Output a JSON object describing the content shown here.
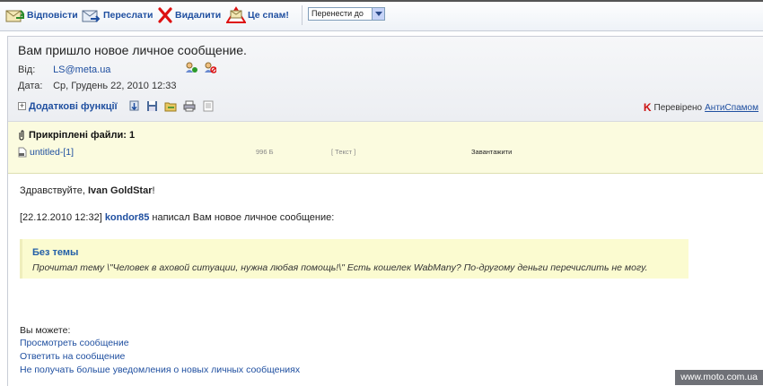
{
  "toolbar": {
    "reply_label": "Відповісти",
    "forward_label": "Переслати",
    "delete_label": "Видалити",
    "spam_label": "Це спам!",
    "move_select_value": "Перенести до"
  },
  "message": {
    "subject": "Вам пришло новое личное сообщение.",
    "from_label": "Від:",
    "from_value": "LS@meta.ua",
    "date_label": "Дата:",
    "date_value": "Ср, Грудень 22, 2010 12:33",
    "extra_functions_label": "Додаткові функції",
    "verified_text": "Перевірено",
    "verified_link": "АнтиСпамом"
  },
  "attachments": {
    "title": "Прикріплені файли: 1",
    "files": [
      {
        "name": "untitled-[1]",
        "size": "996 Б",
        "type": "[ Текст ]",
        "download": "Завантажити"
      }
    ]
  },
  "body": {
    "greeting_prefix": "Здравствуйте,",
    "greeting_name": "Ivan GoldStar",
    "greeting_suffix": "!",
    "notice_time": "[22.12.2010 12:32]",
    "notice_author": "kondor85",
    "notice_text": "написал Вам новое личное сообщение:",
    "quote_title": "Без темы",
    "quote_text": "Прочитал тему \\\"Человек в аховой ситуации, нужна любая помощь!\\\" Есть кошелек WabMany? По-другому деньги перечислить не могу.",
    "options_label": "Вы можете:",
    "actions": [
      "Просмотреть сообщение",
      "Ответить на сообщение",
      "Не получать больше уведомления о новых личных сообщениях"
    ]
  },
  "watermark": "www.moto.com.ua",
  "icons": [
    "reply-icon",
    "forward-icon",
    "delete-icon",
    "spam-icon",
    "add-contact-icon",
    "block-contact-icon",
    "attachment-clip-icon",
    "file-icon",
    "download-icon",
    "save-icon",
    "folder-icon",
    "print-icon",
    "rfc-icon",
    "antispam-k-icon"
  ],
  "colors": {
    "link": "#1f4fa0",
    "quote_bg": "#fbfbd0",
    "attach_bg": "#fbfbdf",
    "spam_red": "#cc1111"
  }
}
